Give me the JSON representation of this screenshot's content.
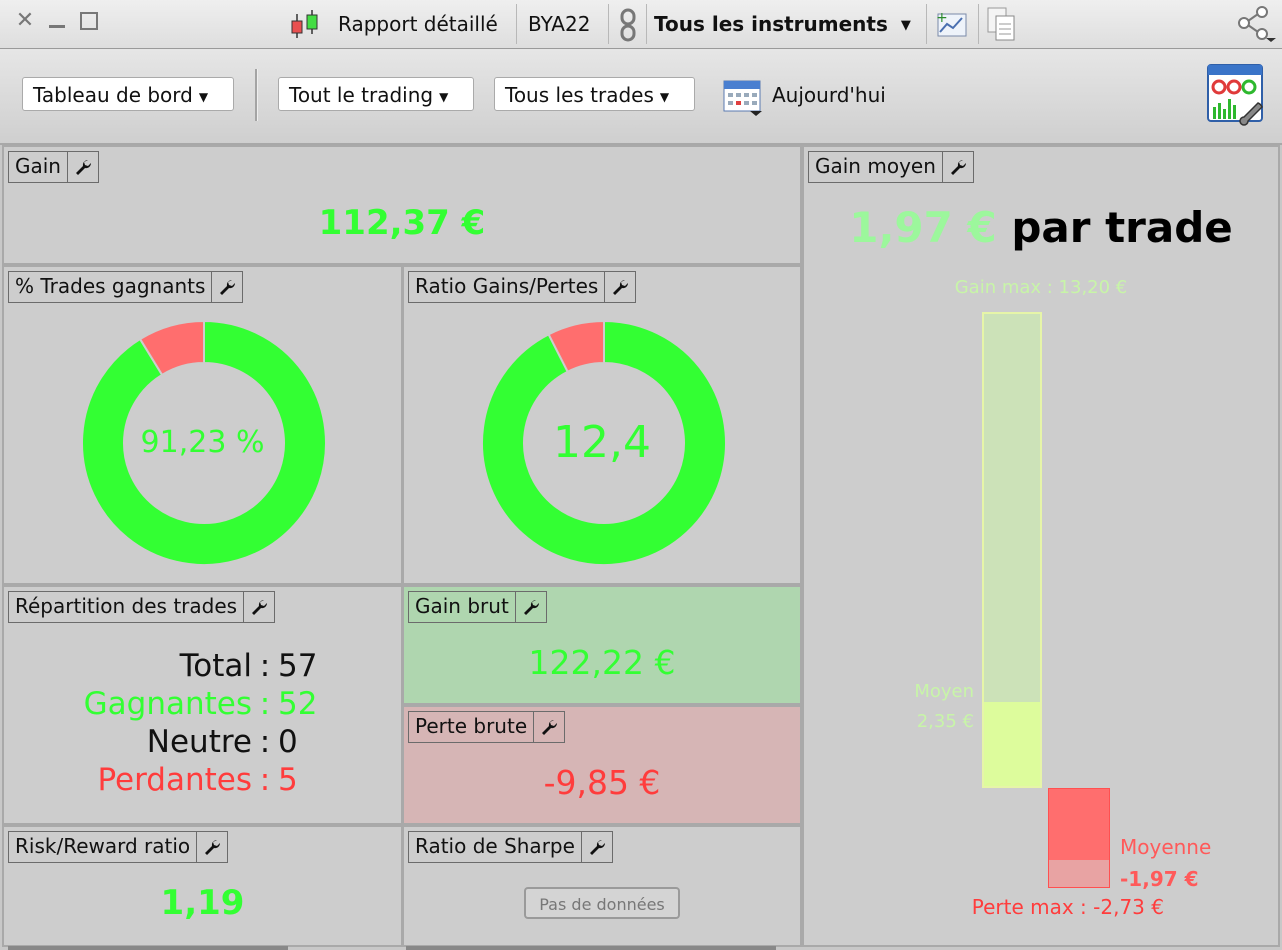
{
  "titlebar": {
    "report_label": "Rapport détaillé",
    "account": "BYA22",
    "instruments": "Tous les instruments"
  },
  "toolbar": {
    "dashboard": "Tableau de bord",
    "trading": "Tout le trading",
    "trades": "Tous les trades",
    "date": "Aujourd'hui"
  },
  "panels": {
    "gain": {
      "title": "Gain",
      "value": "112,37 €"
    },
    "win_rate": {
      "title": "% Trades gagnants",
      "value": "91,23 %",
      "fraction": 0.9123
    },
    "ratio": {
      "title": "Ratio Gains/Pertes",
      "value": "12,4",
      "fraction": 0.925
    },
    "distribution": {
      "title": "Répartition des trades",
      "rows": [
        {
          "label": "Total",
          "value": "57"
        },
        {
          "label": "Gagnantes",
          "value": "52"
        },
        {
          "label": "Neutre",
          "value": "0"
        },
        {
          "label": "Perdantes",
          "value": "5"
        }
      ]
    },
    "gross_gain": {
      "title": "Gain brut",
      "value": "122,22 €"
    },
    "gross_loss": {
      "title": "Perte brute",
      "value": "-9,85 €"
    },
    "risk_reward": {
      "title": "Risk/Reward ratio",
      "value": "1,19"
    },
    "sharpe": {
      "title": "Ratio de Sharpe",
      "empty": "Pas de données"
    },
    "avg_gain": {
      "title": "Gain moyen",
      "value": "1,97 €",
      "suffix": "par trade",
      "max_label": "Gain max : 13,20 €",
      "mean_label": "Moyen",
      "mean_value": "2,35 €",
      "loss_mean_label": "Moyenne",
      "loss_mean_value": "-1,97 €",
      "loss_max_label": "Perte max : -2,73 €",
      "gain_max": 13.2,
      "gain_mean": 2.35,
      "loss_mean": 1.97,
      "loss_max": 2.73
    }
  },
  "colors": {
    "win": "#33ff33",
    "loss": "#ff6e6e"
  }
}
